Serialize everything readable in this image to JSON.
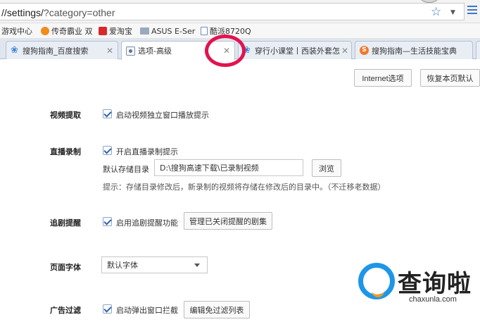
{
  "address_bar": {
    "url_prefix": "//settings/",
    "url_rest": "?category=other"
  },
  "bookmarks": [
    {
      "label": "游戏中心",
      "icon": "game-icon"
    },
    {
      "label": "传奇霸业 双",
      "icon": "orange-icon"
    },
    {
      "label": "爱淘宝",
      "icon": "taobao-icon"
    },
    {
      "label": "ASUS E-Ser",
      "icon": "folder-icon"
    },
    {
      "label": "酷派8720Q",
      "icon": "doc-icon"
    }
  ],
  "tabs": [
    {
      "label": "搜狗指南_百度搜索",
      "icon": "paw-icon",
      "active": false
    },
    {
      "label": "选项-高级",
      "icon": "settings-icon",
      "active": true
    },
    {
      "label": "穿行小课堂丨西装外套怎",
      "icon": "paw-icon",
      "active": false
    },
    {
      "label": "搜狗指南—生活技能宝典",
      "icon": "sogou-icon",
      "active": false
    }
  ],
  "header_buttons": {
    "internet_options": "Internet选项",
    "restore_defaults": "恢复本页默认"
  },
  "settings": {
    "video": {
      "label": "视频提取",
      "option": "启动视频独立窗口播放提示",
      "checked": true
    },
    "live": {
      "label": "直播录制",
      "option": "开启直播录制提示",
      "checked": true,
      "storage_label": "默认存储目录",
      "storage_path": "D:\\搜狗高速下载\\已录制视频",
      "browse": "浏览",
      "hint": "提示：存储目录修改后，新录制的视频将存储在修改后的目录中。（不迁移老数据）"
    },
    "series": {
      "label": "追剧提醒",
      "option": "启用追剧提醒功能",
      "checked": true,
      "manage": "管理已关闭提醒的剧集"
    },
    "font": {
      "label": "页面字体",
      "selected": "默认字体"
    },
    "adblock": {
      "label": "广告过滤",
      "option": "启动弹出窗口拦截",
      "checked": true,
      "edit": "编辑免过滤列表"
    }
  },
  "watermark": {
    "cn": "查询啦",
    "en": "chaxunla.com"
  },
  "colors": {
    "accent": "#3b82d6",
    "annotation_circle": "#e2134f",
    "watermark_blue": "#1e96e7",
    "watermark_orange": "#f39a1c"
  }
}
